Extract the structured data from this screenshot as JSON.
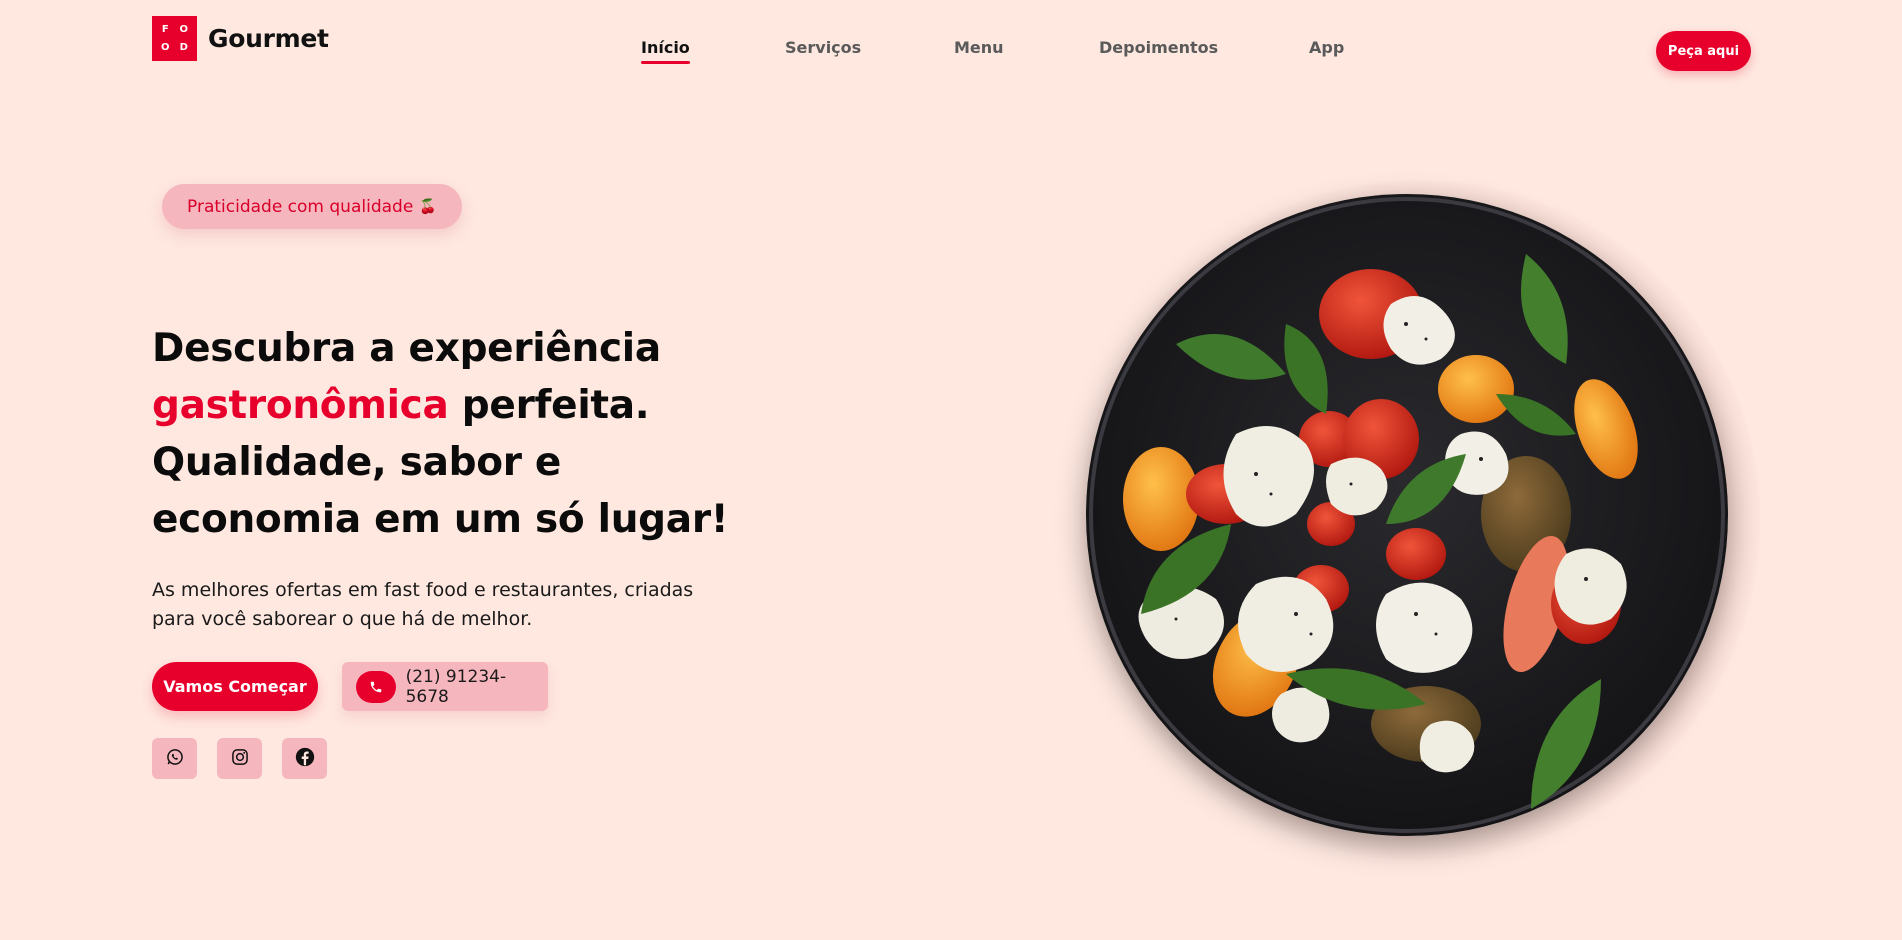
{
  "header": {
    "logo_letters": [
      "F",
      "O",
      "O",
      "D"
    ],
    "brand": "Gourmet",
    "nav": [
      {
        "label": "Início",
        "active": true
      },
      {
        "label": "Serviços",
        "active": false
      },
      {
        "label": "Menu",
        "active": false
      },
      {
        "label": "Depoimentos",
        "active": false
      },
      {
        "label": "App",
        "active": false
      }
    ],
    "order_button": "Peça aqui"
  },
  "hero": {
    "badge": "Praticidade com qualidade",
    "badge_emoji": "🍒",
    "headline_part1": "Descubra a experiência",
    "headline_accent": "gastronômica",
    "headline_part2": " perfeita.",
    "headline_line3": "Qualidade, sabor e",
    "headline_line4": "economia em um só lugar!",
    "subtext": "As melhores ofertas em fast food e restaurantes, criadas para você saborear o que há de melhor.",
    "cta_button": "Vamos Começar",
    "phone": "(21) 91234-5678",
    "social_icons": [
      "whatsapp-icon",
      "instagram-icon",
      "facebook-icon"
    ],
    "image_subject": "salad plate with tomatoes, mozzarella and basil"
  },
  "colors": {
    "background": "#FEE8E0",
    "accent": "#E8002D",
    "soft_pink": "#F6B6BD",
    "text": "#111111"
  }
}
